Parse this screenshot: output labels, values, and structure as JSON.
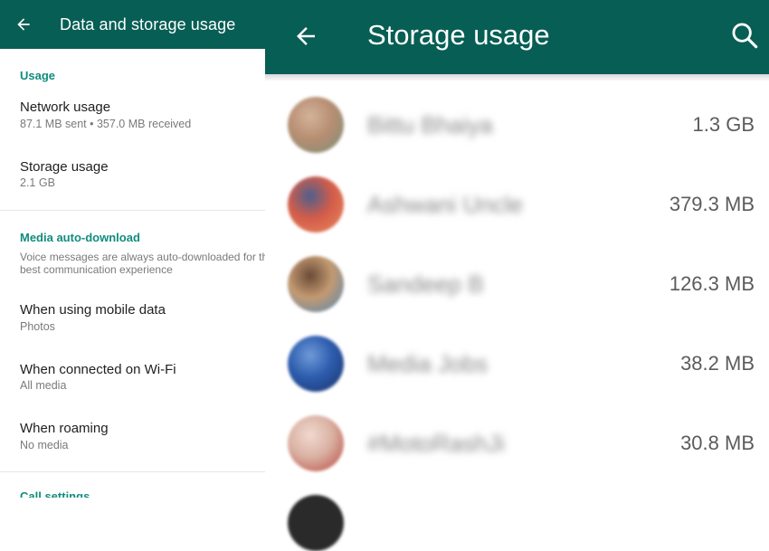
{
  "left": {
    "title": "Data and storage usage",
    "usage_label": "Usage",
    "network_title": "Network usage",
    "network_sub": "87.1 MB sent • 357.0 MB received",
    "storage_title": "Storage usage",
    "storage_sub": "2.1 GB",
    "media_label": "Media auto-download",
    "note_line1": "Voice messages are always auto-downloaded for the",
    "note_line2": "best communication experience",
    "mobile_title": "When using mobile data",
    "mobile_sub": "Photos",
    "wifi_title": "When connected on Wi-Fi",
    "wifi_sub": "All media",
    "roaming_title": "When roaming",
    "roaming_sub": "No media",
    "call_label": "Call settings"
  },
  "right": {
    "title": "Storage usage",
    "contacts": [
      {
        "name": "Bittu Bhaiya",
        "size": "1.3 GB",
        "colors": [
          "#b78e72",
          "#7a8f78",
          "#d3b39b"
        ]
      },
      {
        "name": "Ashwani Uncle",
        "size": "379.3 MB",
        "colors": [
          "#d35c4a",
          "#e98a5c",
          "#4f5f8c"
        ]
      },
      {
        "name": "Sandeep B",
        "size": "126.3 MB",
        "colors": [
          "#c39a72",
          "#4e86b8",
          "#6a4a36"
        ]
      },
      {
        "name": "Media Jobs",
        "size": "38.2 MB",
        "colors": [
          "#2d5cae",
          "#1a3166",
          "#6f9ad8"
        ]
      },
      {
        "name": "#MotoRashJi",
        "size": "30.8 MB",
        "colors": [
          "#d9b1a3",
          "#b9453a",
          "#f1d9cf"
        ]
      }
    ]
  },
  "colors": {
    "header": "#075e54",
    "accent": "#128c7e"
  }
}
